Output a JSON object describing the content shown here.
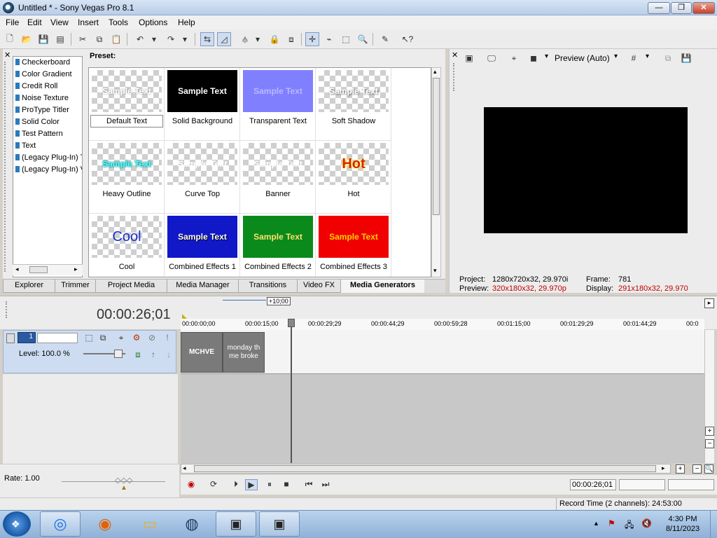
{
  "window": {
    "title": "Untitled * - Sony Vegas Pro 8.1"
  },
  "menus": [
    "File",
    "Edit",
    "View",
    "Insert",
    "Tools",
    "Options",
    "Help"
  ],
  "generators": {
    "preset_label": "Preset:",
    "list": [
      "Checkerboard",
      "Color Gradient",
      "Credit Roll",
      "Noise Texture",
      "ProType Titler",
      "Solid Color",
      "Test Pattern",
      "Text",
      "(Legacy Plug-In) T",
      "(Legacy Plug-In) V"
    ],
    "presets": [
      {
        "label": "Default Text",
        "thumb": "Sample Text"
      },
      {
        "label": "Solid Background",
        "thumb": "Sample Text"
      },
      {
        "label": "Transparent Text",
        "thumb": "Sample Text"
      },
      {
        "label": "Soft Shadow",
        "thumb": "Sample Text"
      },
      {
        "label": "Heavy Outline",
        "thumb": "Sample Text"
      },
      {
        "label": "Curve Top",
        "thumb": "Sample Text"
      },
      {
        "label": "Banner",
        "thumb": "Sample Text"
      },
      {
        "label": "Hot",
        "thumb": "Hot"
      },
      {
        "label": "Cool",
        "thumb": "Cool"
      },
      {
        "label": "Combined Effects 1",
        "thumb": "Sample Text"
      },
      {
        "label": "Combined Effects 2",
        "thumb": "Sample Text"
      },
      {
        "label": "Combined Effects 3",
        "thumb": "Sample Text"
      }
    ]
  },
  "tabs": [
    "Explorer",
    "Trimmer",
    "Project Media",
    "Media Manager",
    "Transitions",
    "Video FX",
    "Media Generators"
  ],
  "preview": {
    "mode": "Preview (Auto)",
    "project_label": "Project:",
    "project_value": "1280x720x32, 29.970i",
    "frame_label": "Frame:",
    "frame_value": "781",
    "preview_label": "Preview:",
    "preview_value": "320x180x32, 29.970p",
    "display_label": "Display:",
    "display_value": "291x180x32, 29.970"
  },
  "timeline": {
    "timecode": "00:00:26;01",
    "offset": "+10;00",
    "ruler": [
      "00:00:00;00",
      "00:00:15;00",
      "00:00:29;29",
      "00:00:44;29",
      "00:00:59;28",
      "00:01:15;00",
      "00:01:29;29",
      "00:01:44;29",
      "00:0"
    ],
    "track_number": "1",
    "level": "Level: 100.0 %",
    "clip1": "MCHVE",
    "clip2": "monday th me broke",
    "rate": "Rate: 1.00",
    "transport_time": "00:00:26;01"
  },
  "status": {
    "record_time": "Record Time (2 channels): 24:53:00"
  },
  "taskbar": {
    "time": "4:30 PM",
    "date": "8/11/2023"
  }
}
